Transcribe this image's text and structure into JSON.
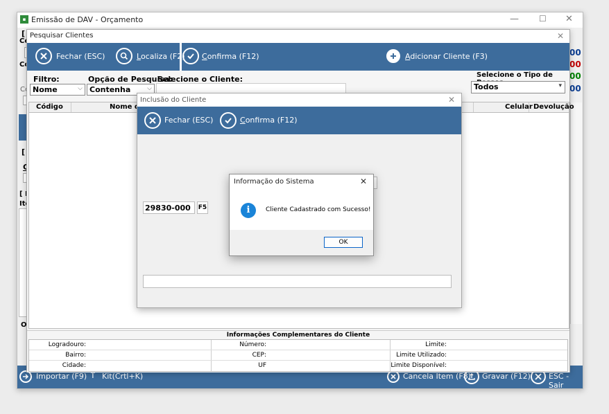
{
  "main_window": {
    "title": "Emissão de DAV - Orçamento",
    "side_numbers": [
      "00",
      "00",
      "00",
      "00"
    ],
    "partial_labels": [
      "[",
      "Có",
      "Co",
      "Cc",
      "[",
      "C",
      "[ F",
      "Ite",
      "Ol"
    ],
    "bottom_toolbar": {
      "import": "Importar (F9)",
      "kit": "Kit(Crtl+K)",
      "cancel_item": "Cancela Item (F8)",
      "save": "Gravar (F12)",
      "exit": "ESC - Sair"
    }
  },
  "search_window": {
    "title": "Pesquisar Clientes",
    "toolbar": {
      "close": "Fechar (ESC)",
      "locate": "Localiza (F2)",
      "confirm": "Confirma (F12)",
      "add_client": "Adicionar Cliente (F3)"
    },
    "filter": {
      "filter_label": "Filtro:",
      "filter_value": "Nome",
      "option_label": "Opção de Pesquisa:",
      "option_value": "Contenha",
      "select_client_label": "Selecione o Cliente:",
      "person_type_label": "Selecione o Tipo de Pessoa",
      "person_type_value": "Todos"
    },
    "columns": [
      "Código",
      "Nome do",
      "Celular",
      "Devolução"
    ],
    "info_section": {
      "title": "Informações Complementares do Cliente",
      "rows": [
        [
          "Logradouro:",
          "Número:",
          "Limite:"
        ],
        [
          "Bairro:",
          "CEP:",
          "Limite Utilizado:"
        ],
        [
          "Cidade:",
          "UF",
          "Limite Disponível:"
        ]
      ]
    }
  },
  "inclusion_window": {
    "title": "Inclusão do Cliente",
    "toolbar": {
      "close": "Fechar (ESC)",
      "confirm": "Confirma (F12)"
    },
    "cep_value": "29830-000",
    "cep_button": "F5"
  },
  "dialog": {
    "title": "Informação do Sistema",
    "message": "Cliente Cadastrado com Sucesso!",
    "ok": "OK",
    "close_glyph": "✕"
  },
  "colors": {
    "toolbar_blue": "#3d6c9c",
    "info_icon_blue": "#1a84d8",
    "num_blue": "#0b3d91",
    "num_red": "#c00000",
    "num_green": "#008000"
  }
}
